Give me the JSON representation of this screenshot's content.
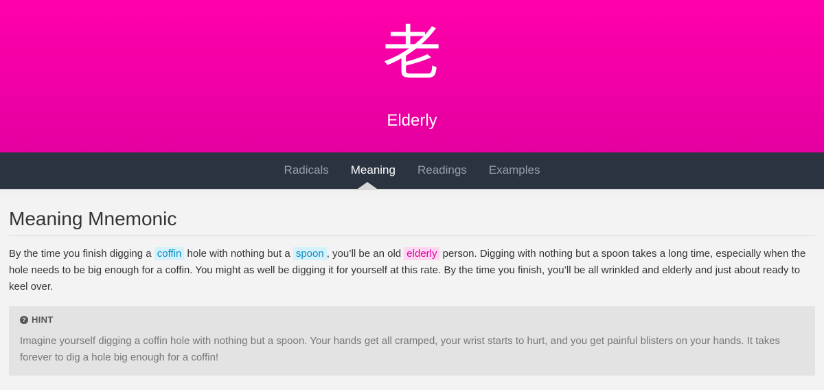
{
  "header": {
    "kanji": "老",
    "meaning": "Elderly"
  },
  "nav": {
    "tabs": [
      {
        "label": "Radicals",
        "active": false
      },
      {
        "label": "Meaning",
        "active": true
      },
      {
        "label": "Readings",
        "active": false
      },
      {
        "label": "Examples",
        "active": false
      }
    ]
  },
  "section": {
    "title": "Meaning Mnemonic",
    "mnemonic": {
      "t1": "By the time you finish digging a ",
      "coffin": "coffin",
      "t2": " hole with nothing but a ",
      "spoon": "spoon",
      "t3": ", you’ll be an old ",
      "elderly": "elderly",
      "t4": " person. Digging with nothing but a spoon takes a long time, especially when the hole needs to be big enough for a coffin. You might as well be digging it for yourself at this rate. By the time you finish, you’ll be all wrinkled and elderly and just about ready to keel over."
    }
  },
  "hint": {
    "label": "HINT",
    "text": "Imagine yourself digging a coffin hole with nothing but a spoon. Your hands get all cramped, your wrist starts to hurt, and you get painful blisters on your hands. It takes forever to dig a hole big enough for a coffin!"
  },
  "colors": {
    "kanji_header": "#ff00aa",
    "nav_bg": "#2b3240",
    "radical_highlight": "#d4f1fc",
    "kanji_highlight": "#ffd6f1"
  }
}
